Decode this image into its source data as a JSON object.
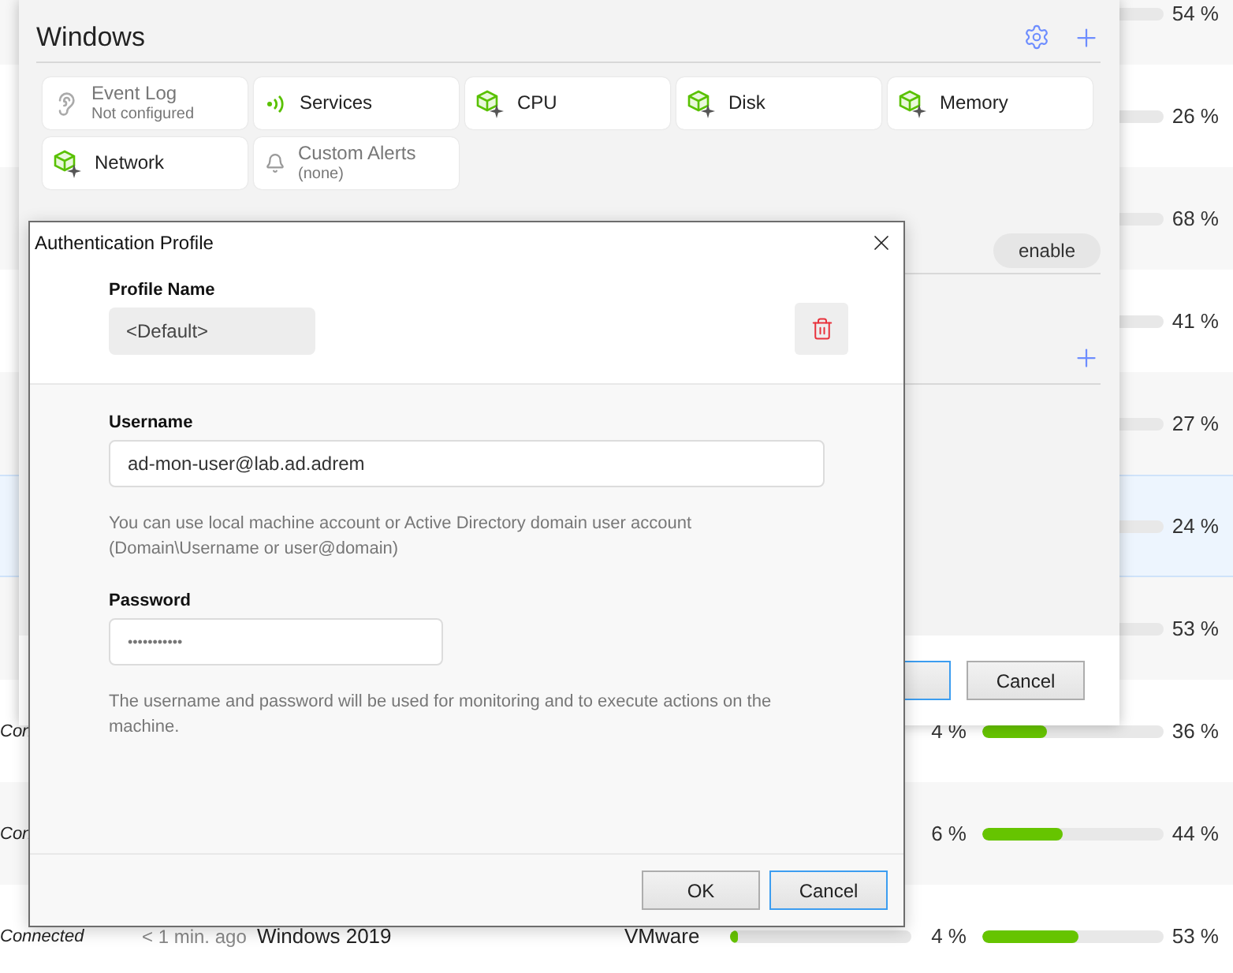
{
  "table": {
    "rows": [
      {
        "memory": {
          "text": "54 %"
        },
        "selected": false
      },
      {
        "memory": {
          "text": "26 %"
        },
        "selected": false
      },
      {
        "memory": {
          "text": "68 %"
        },
        "selected": false
      },
      {
        "memory": {
          "text": "41 %"
        },
        "selected": false
      },
      {
        "memory": {
          "text": "27 %"
        },
        "selected": false
      },
      {
        "memory": {
          "text": "24 %"
        },
        "selected": true
      },
      {
        "memory": {
          "text": "53 %"
        },
        "selected": false
      },
      {
        "status": "Con",
        "cpu": {
          "text": "4 %"
        },
        "memory": {
          "level": 0.36,
          "text": "36 %"
        },
        "selected": false
      },
      {
        "status": "Con",
        "cpu": {
          "text": "6 %"
        },
        "memory": {
          "level": 0.44,
          "text": "44 %"
        },
        "selected": false
      },
      {
        "status": "Connected",
        "time": "< 1 min. ago",
        "os": "Windows 2019",
        "vendor": "VMware",
        "cpu": {
          "level": 0.04,
          "text": "4 %"
        },
        "memory": {
          "level": 0.53,
          "text": "53 %"
        },
        "selected": false
      }
    ]
  },
  "panel": {
    "title": "Windows",
    "tiles": [
      {
        "label": "Event Log",
        "sub": "Not configured",
        "kind": "ear",
        "configured": false
      },
      {
        "label": "Services",
        "kind": "signal",
        "configured": true
      },
      {
        "label": "CPU",
        "kind": "cube",
        "configured": true
      },
      {
        "label": "Disk",
        "kind": "cube",
        "configured": true
      },
      {
        "label": "Memory",
        "kind": "cube",
        "configured": true
      },
      {
        "label": "Network",
        "kind": "cube",
        "configured": true
      },
      {
        "label": "Custom Alerts",
        "sub": "(none)",
        "kind": "bell",
        "configured": false
      }
    ],
    "enable_button": "enable",
    "buttons": [
      {
        "focused": true
      },
      {
        "label": "Cancel",
        "focused": false
      }
    ]
  },
  "dialog": {
    "title": "Authentication Profile",
    "profile_label": "Profile Name",
    "profile_value": "<Default>",
    "username_label": "Username",
    "username_value": "ad-mon-user@lab.ad.adrem",
    "username_hint": "You can use local machine account or Active Directory domain user account (Domain\\Username or user@domain)",
    "password_label": "Password",
    "password_value": "•••••••••••",
    "password_hint": "The username and password will be used for monitoring and to execute actions on the machine.",
    "buttons": [
      {
        "label": "OK",
        "focused": false
      },
      {
        "label": "Cancel",
        "focused": true
      }
    ]
  }
}
